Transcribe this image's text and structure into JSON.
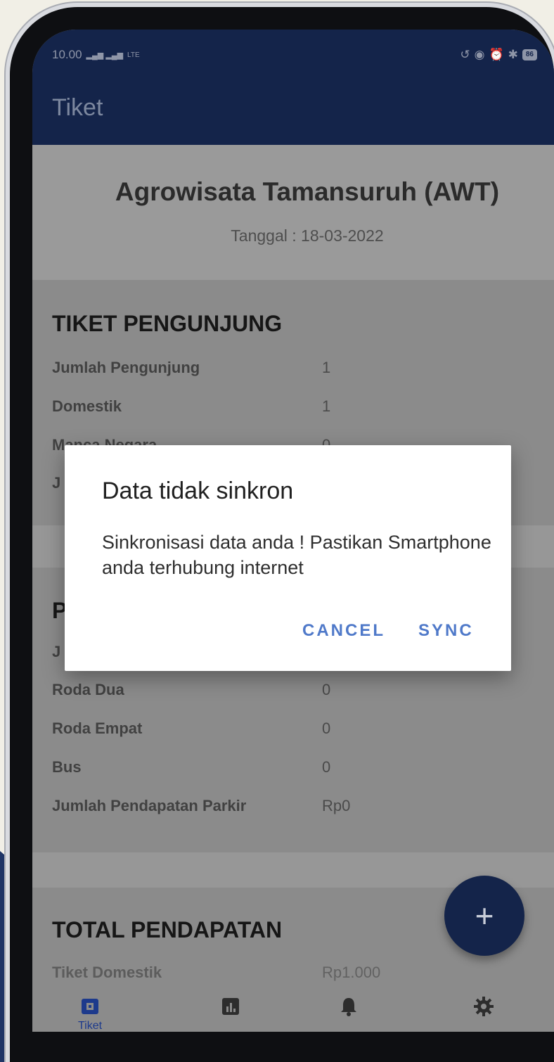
{
  "status_bar": {
    "time": "10.00",
    "signal": "▂▄▆ ▂▄▆",
    "network": "LTE",
    "battery": "86"
  },
  "app_bar": {
    "title": "Tiket"
  },
  "header": {
    "venue": "Agrowisata Tamansuruh (AWT)",
    "date": "Tanggal : 18-03-2022"
  },
  "tiket_pengunjung": {
    "title": "TIKET PENGUNJUNG",
    "rows": [
      {
        "label": "Jumlah Pengunjung",
        "value": "1"
      },
      {
        "label": "Domestik",
        "value": "1"
      },
      {
        "label": "Manca Negara",
        "value": "0"
      },
      {
        "label": "J",
        "value": ""
      }
    ]
  },
  "parkir": {
    "title": "P",
    "rows": [
      {
        "label": "J",
        "value": ""
      },
      {
        "label": "Roda Dua",
        "value": "0"
      },
      {
        "label": "Roda Empat",
        "value": "0"
      },
      {
        "label": "Bus",
        "value": "0"
      },
      {
        "label": "Jumlah Pendapatan Parkir",
        "value": "Rp0"
      }
    ]
  },
  "total_pendapatan": {
    "title": "TOTAL PENDAPATAN",
    "rows": [
      {
        "label": "Tiket Domestik",
        "value": "Rp1.000"
      }
    ]
  },
  "fab": {
    "label": "+"
  },
  "bottom_nav": {
    "items": [
      {
        "label": "Tiket",
        "icon": "ticket-icon",
        "active": true
      },
      {
        "label": "",
        "icon": "chart-icon",
        "active": false
      },
      {
        "label": "",
        "icon": "bell-icon",
        "active": false
      },
      {
        "label": "",
        "icon": "gear-icon",
        "active": false
      }
    ]
  },
  "dialog": {
    "title": "Data tidak sinkron",
    "message": "Sinkronisasi data anda ! Pastikan Smartphone anda terhubung internet",
    "cancel_label": "CANCEL",
    "sync_label": "SYNC"
  },
  "colors": {
    "app_bar": "#14244a",
    "dialog_button": "#4f79c9",
    "nav_active": "#1d3a8c"
  }
}
